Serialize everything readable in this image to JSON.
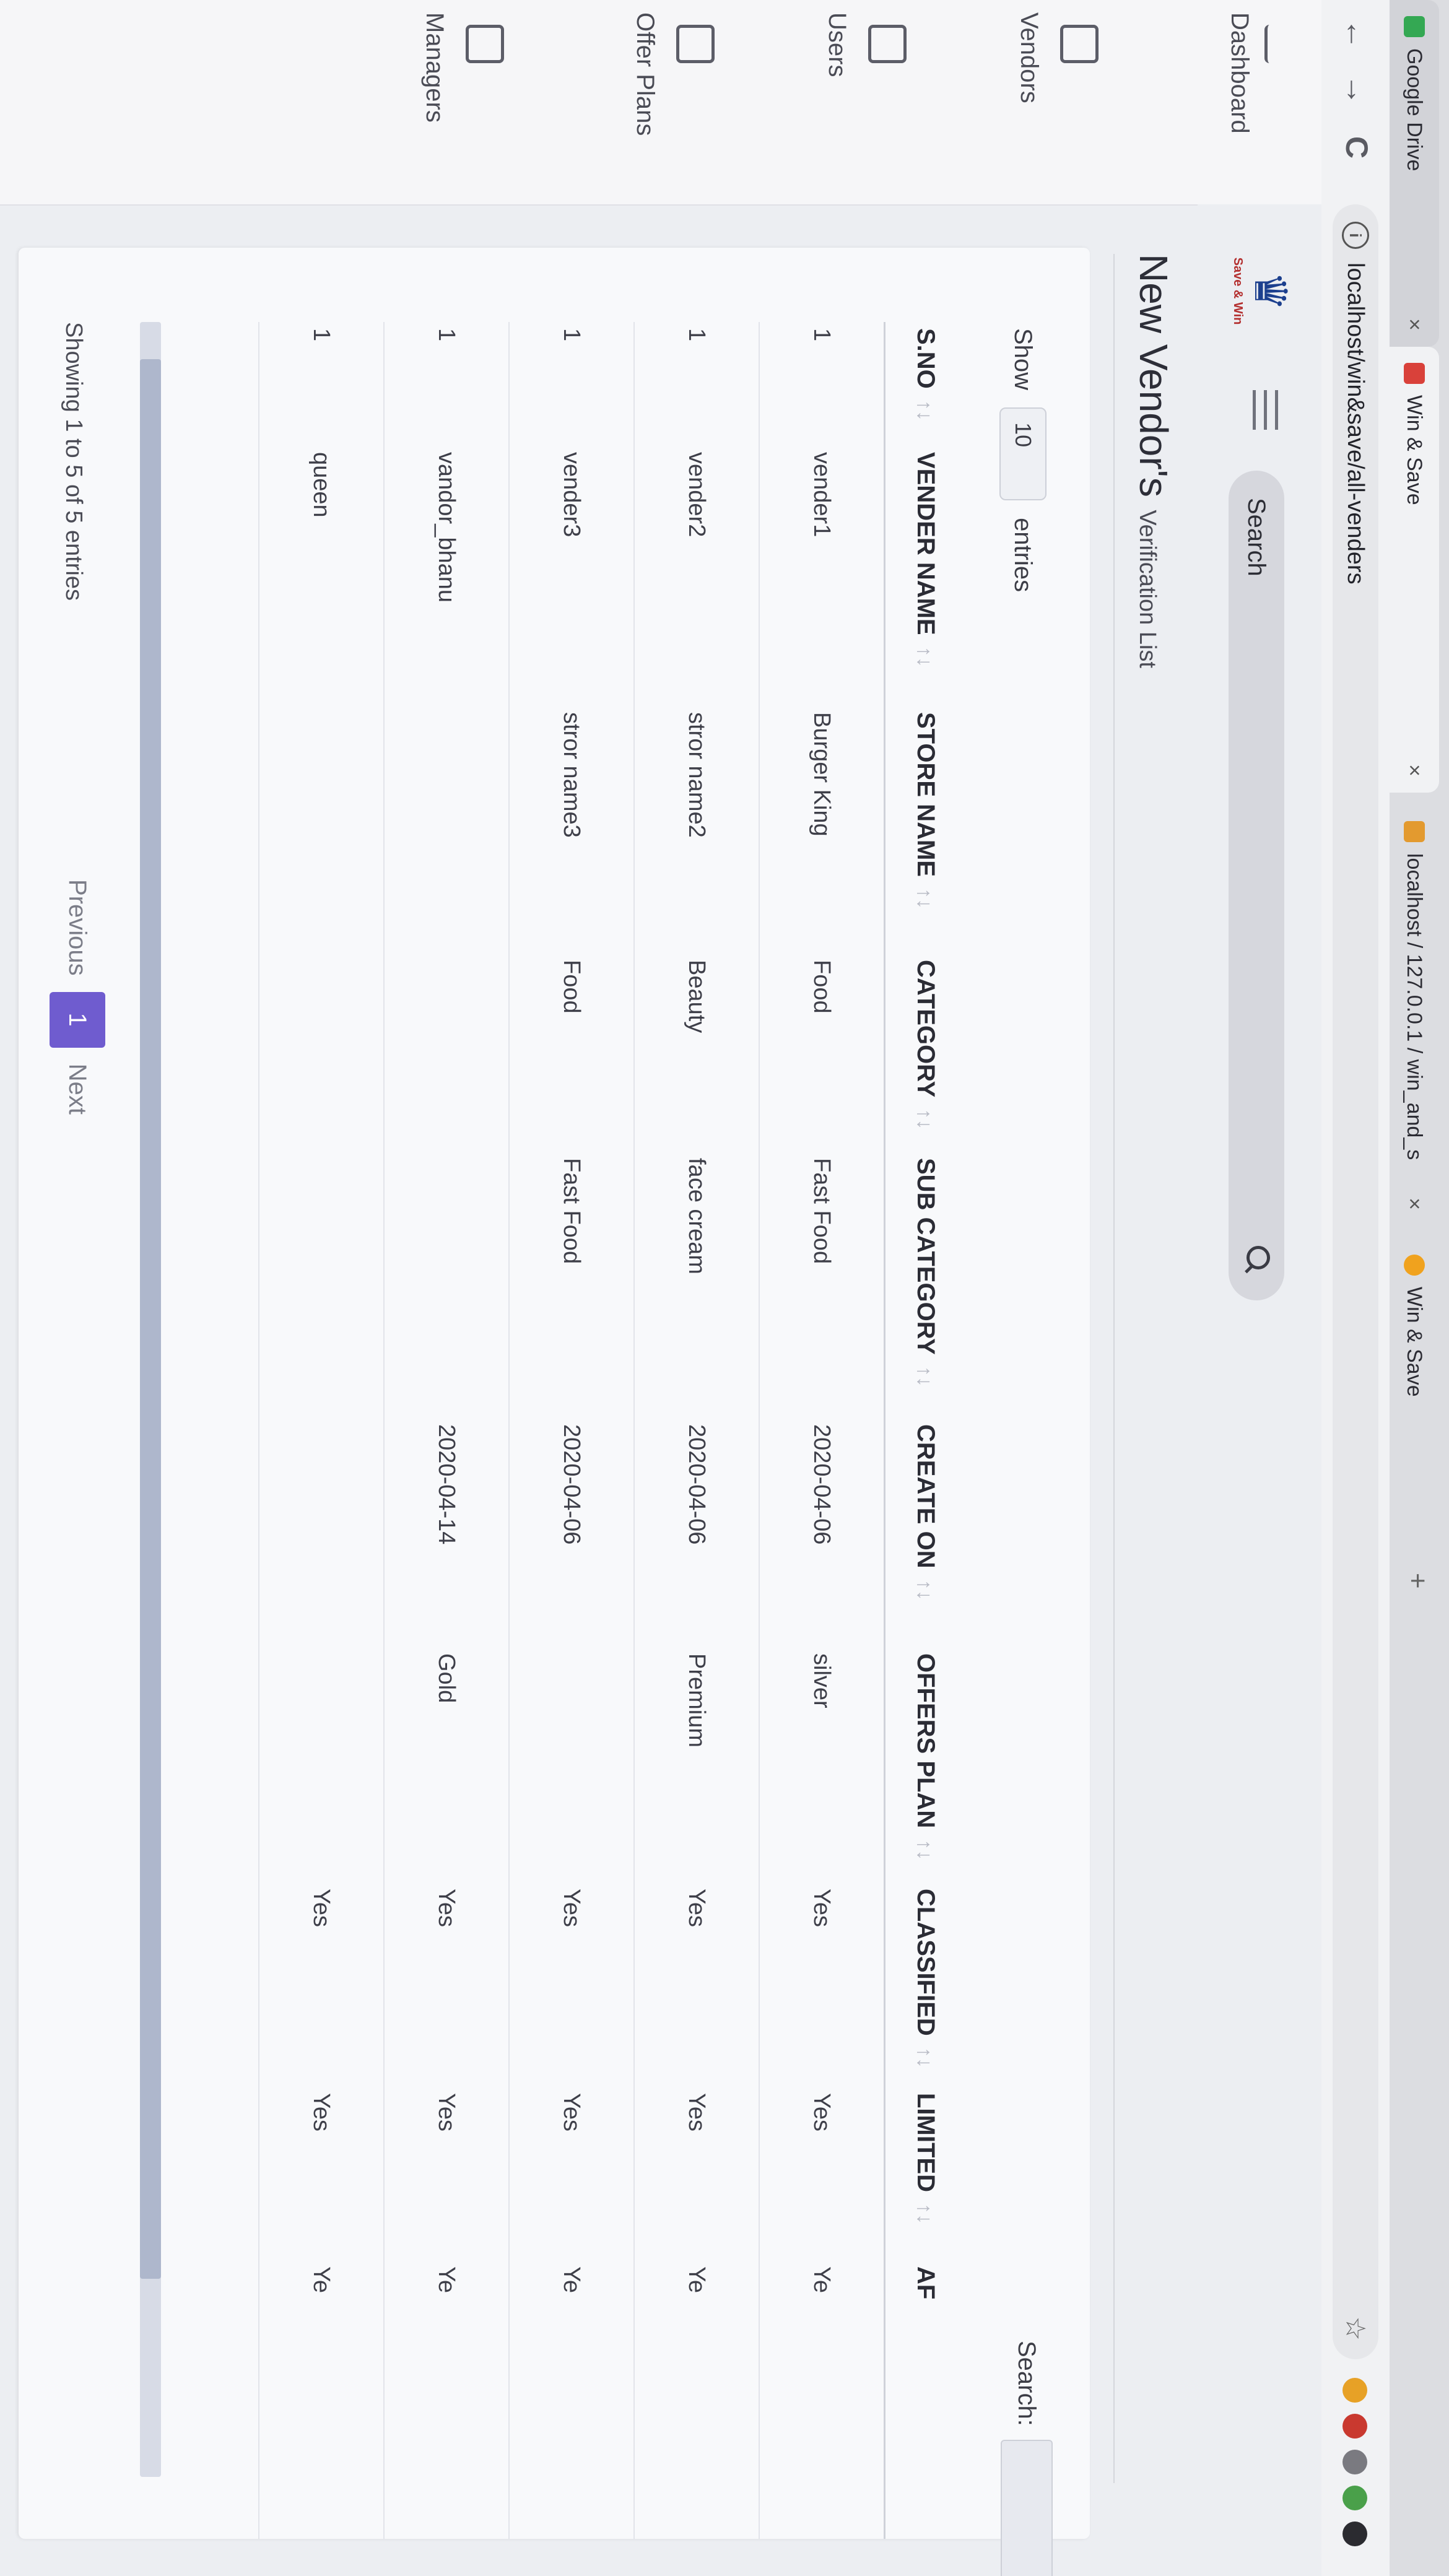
{
  "browser": {
    "tabs": [
      {
        "title": "Google Drive",
        "close": "×"
      },
      {
        "title": "Win & Save",
        "close": "×"
      },
      {
        "title": "localhost / 127.0.0.1 / win_and_s",
        "close": "×"
      },
      {
        "title": "Win & Save",
        "close": ""
      }
    ],
    "new_tab": "+",
    "back": "←",
    "forward": "→",
    "reload": "C",
    "url": "localhost/win&save/all-venders",
    "info_icon": "i",
    "star": "☆"
  },
  "sidebar": {
    "items": [
      {
        "label": "Dashboard",
        "icon": "chart-icon"
      },
      {
        "label": "Vendors",
        "icon": "id-card-icon"
      },
      {
        "label": "Users",
        "icon": "users-icon"
      },
      {
        "label": "Offer Plans",
        "icon": "package-icon"
      },
      {
        "label": "Managers",
        "icon": "manager-icon"
      }
    ]
  },
  "header": {
    "brand": "Save & Win",
    "search_placeholder": "Search"
  },
  "page": {
    "title": "New Vendor's",
    "subtitle": "Verification List"
  },
  "table_controls": {
    "show_label": "Show",
    "entries_value": "10",
    "entries_label": "entries",
    "search_label": "Search:",
    "search_value": ""
  },
  "table": {
    "columns": [
      "S.NO",
      "VENDER NAME",
      "STORE NAME",
      "CATEGORY",
      "SUB CATEGORY",
      "CREATE ON",
      "OFFERS PLAN",
      "CLASSIFIED",
      "LIMITED",
      "AF"
    ],
    "sort_icon": "↑↓",
    "rows": [
      [
        "1",
        "vender1",
        "Burger King",
        "Food",
        "Fast Food",
        "2020-04-06",
        "silver",
        "Yes",
        "Yes",
        "Ye"
      ],
      [
        "1",
        "vender2",
        "stror name2",
        "Beauty",
        "face cream",
        "2020-04-06",
        "Premium",
        "Yes",
        "Yes",
        "Ye"
      ],
      [
        "1",
        "vender3",
        "stror name3",
        "Food",
        "Fast Food",
        "2020-04-06",
        "",
        "Yes",
        "Yes",
        "Ye"
      ],
      [
        "1",
        "vandor_bhanu",
        "",
        "",
        "",
        "2020-04-14",
        "Gold",
        "Yes",
        "Yes",
        "Ye"
      ],
      [
        "1",
        "queen",
        "",
        "",
        "",
        "",
        "",
        "Yes",
        "Yes",
        "Ye"
      ]
    ]
  },
  "footer": {
    "info": "Showing 1 to 5 of 5 entries",
    "previous": "Previous",
    "current_page": "1",
    "next": "Next"
  },
  "colors": {
    "accent": "#6f5ccf",
    "page_bg": "#eceef2",
    "card_bg": "#f8f9fb",
    "text": "#3c3c44"
  }
}
